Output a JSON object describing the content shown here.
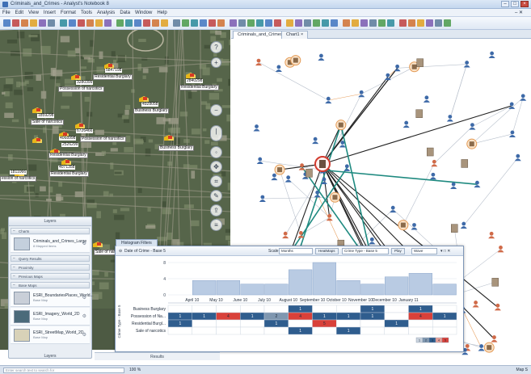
{
  "window": {
    "title": "Criminals_and_Crimes - Analyst's Notebook 8"
  },
  "menu": {
    "items": [
      "File",
      "Edit",
      "View",
      "Insert",
      "Format",
      "Tools",
      "Analysis",
      "Data",
      "Window",
      "Help"
    ]
  },
  "tabs": [
    {
      "label": "Criminals_and_Crimes"
    },
    {
      "label": "Chart1"
    }
  ],
  "map": {
    "numbers": [
      "5847198",
      "3280399",
      "2840298",
      "4928058",
      "1859298",
      "6726466",
      "4068998",
      "2526299",
      "4071358",
      "1811066"
    ],
    "labels": [
      "Residential Burglary",
      "Possession of narcotics",
      "Residential Burglary",
      "Business Burglary",
      "Sale of narcotics",
      "Residential Burglary",
      "Business Burglary",
      "Possession of narcotics",
      "Residential Burglary",
      "ession of narcotics",
      "Sale of narcotics"
    ]
  },
  "layers": {
    "title": "Layers",
    "sections": [
      "Charts",
      "Query Results",
      "Proximity",
      "Previous Maps",
      "Base Maps"
    ],
    "items": [
      {
        "name": "Criminals_and_Crimes_Large",
        "sub": "8 Mapped items"
      },
      {
        "name": "ESRI_BoundariesPlaces_World...",
        "sub": "Base Map"
      },
      {
        "name": "ESRI_Imagery_World_2D",
        "sub": "Base Map"
      },
      {
        "name": "ESRI_StreetMap_World_2D",
        "sub": "Base Map"
      }
    ],
    "tab_label": "Layers"
  },
  "histogram": {
    "window_title": "Histogram Filters",
    "date_label": "Date of Crime - Base 5",
    "scale_label": "Scale",
    "scale_value": "Months",
    "heatmaps_label": "HeatMaps",
    "heatmaps_value": "Crime Type - Base 5",
    "play_label": "Play",
    "play_mode": "Wave",
    "months": [
      "April 10",
      "May 10",
      "June 10",
      "July 10",
      "August 10",
      "September 10",
      "October 10",
      "November 10",
      "December 10",
      "January 11"
    ],
    "bar_values": [
      0,
      4,
      4,
      3,
      3,
      7,
      9,
      4,
      3,
      5,
      6,
      3
    ],
    "y_ticks": [
      "8",
      "4",
      "0"
    ],
    "row_axis_label": "Crime Type - Base 5",
    "rows": [
      {
        "label": "Business Burglary",
        "values": [
          0,
          0,
          0,
          0,
          0,
          1,
          0,
          0,
          1,
          0,
          1,
          0
        ]
      },
      {
        "label": "Possession of Na...",
        "values": [
          1,
          1,
          4,
          1,
          2,
          4,
          1,
          1,
          1,
          0,
          4,
          1
        ]
      },
      {
        "label": "Residential Burgl...",
        "values": [
          1,
          0,
          0,
          0,
          1,
          0,
          5,
          0,
          0,
          1,
          0,
          0
        ]
      },
      {
        "label": "Sale of narcotics",
        "values": [
          0,
          0,
          0,
          0,
          0,
          1,
          0,
          1,
          0,
          0,
          0,
          0
        ]
      }
    ],
    "legend_values": [
      "1",
      "2",
      "3",
      "4",
      "5"
    ],
    "colors": {
      "blue": "#2f5d8e",
      "mid": "#7f97b0",
      "red": "#d9413a",
      "light": "#e8a098"
    }
  },
  "results_tab": {
    "label": "Results"
  },
  "status": {
    "search_placeholder": "Enter search text to search for",
    "zoom": "100 %",
    "right_text": "Map S"
  }
}
